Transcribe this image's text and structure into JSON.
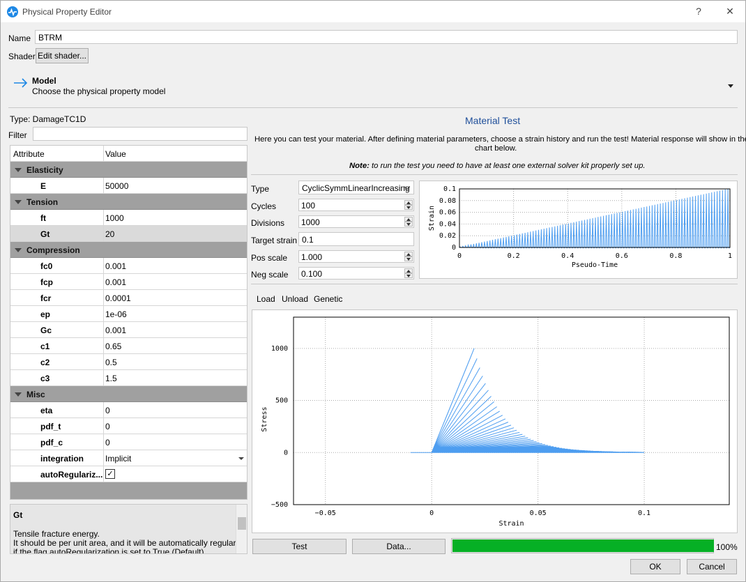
{
  "window": {
    "title": "Physical Property Editor",
    "help": "?",
    "close": "✕"
  },
  "name_label": "Name",
  "name_value": "BTRM",
  "shader_label": "Shader",
  "shader_button": "Edit shader...",
  "model": {
    "title": "Model",
    "subtitle": "Choose the physical property model"
  },
  "type_line": "Type:  DamageTC1D",
  "filter_label": "Filter",
  "filter_value": "",
  "table": {
    "col_attr": "Attribute",
    "col_value": "Value",
    "rows": [
      {
        "kind": "cat",
        "name": "Elasticity"
      },
      {
        "kind": "prop",
        "name": "E",
        "value": "50000"
      },
      {
        "kind": "cat",
        "name": "Tension"
      },
      {
        "kind": "prop",
        "name": "ft",
        "value": "1000"
      },
      {
        "kind": "prop",
        "name": "Gt",
        "value": "20",
        "selected": true
      },
      {
        "kind": "cat",
        "name": "Compression"
      },
      {
        "kind": "prop",
        "name": "fc0",
        "value": "0.001"
      },
      {
        "kind": "prop",
        "name": "fcp",
        "value": "0.001"
      },
      {
        "kind": "prop",
        "name": "fcr",
        "value": "0.0001"
      },
      {
        "kind": "prop",
        "name": "ep",
        "value": "1e-06"
      },
      {
        "kind": "prop",
        "name": "Gc",
        "value": "0.001"
      },
      {
        "kind": "prop",
        "name": "c1",
        "value": "0.65"
      },
      {
        "kind": "prop",
        "name": "c2",
        "value": "0.5"
      },
      {
        "kind": "prop",
        "name": "c3",
        "value": "1.5"
      },
      {
        "kind": "cat",
        "name": "Misc"
      },
      {
        "kind": "prop",
        "name": "eta",
        "value": "0"
      },
      {
        "kind": "prop",
        "name": "pdf_t",
        "value": "0"
      },
      {
        "kind": "prop",
        "name": "pdf_c",
        "value": "0"
      },
      {
        "kind": "prop",
        "name": "integration",
        "value": "Implicit",
        "dropdown": true
      },
      {
        "kind": "prop",
        "name": "autoRegulariz...",
        "value": "✓",
        "checkbox": true
      }
    ]
  },
  "description": {
    "title": "Gt",
    "line1": "Tensile fracture energy.",
    "line2": "It should be per unit area, and it will be automatically regularized",
    "line3": "if the flag autoRegularization is set to True (Default)."
  },
  "material_test": {
    "title": "Material Test",
    "intro1": "Here you can test your material. After defining material parameters, choose a strain history and run the test! Material response will show in the",
    "intro2": "chart below.",
    "note_bold": "Note:",
    "note_rest": " to run the test you need to have at least one external solver kit properly set up."
  },
  "params": {
    "type_label": "Type",
    "type_value": "CyclicSymmLinearIncreasing",
    "cycles_label": "Cycles",
    "cycles_value": "100",
    "divisions_label": "Divisions",
    "divisions_value": "1000",
    "target_label": "Target strain",
    "target_value": "0.1",
    "pos_label": "Pos scale",
    "pos_value": "1.000",
    "neg_label": "Neg scale",
    "neg_value": "0.100"
  },
  "tabs": [
    "Load",
    "Unload",
    "Genetic"
  ],
  "buttons": {
    "test": "Test",
    "data": "Data...",
    "ok": "OK",
    "cancel": "Cancel"
  },
  "progress": {
    "value": 100,
    "text": "100%",
    "color": "#06b025"
  },
  "chart_data": [
    {
      "type": "line",
      "title": "",
      "xlabel": "Pseudo-Time",
      "ylabel": "Strain",
      "xlim": [
        0,
        1
      ],
      "ylim": [
        0,
        0.1
      ],
      "xticks": [
        "0",
        "0.2",
        "0.4",
        "0.6",
        "0.8",
        "1"
      ],
      "yticks": [
        "0",
        "0.02",
        "0.04",
        "0.06",
        "0.08",
        "0.1"
      ],
      "series": [
        {
          "description": "cyclic strain history, 100 cycles, amplitude increasing from 0.001 to 0.1, negative side 0.1 x positive",
          "color": "#4d9df0",
          "cycles": 100,
          "amp_start": 0.001,
          "amp_end": 0.1,
          "neg_scale": 0.1
        }
      ],
      "grid": true
    },
    {
      "type": "line",
      "title": "",
      "xlabel": "Strain",
      "ylabel": "Stress",
      "xlim": [
        -0.065,
        0.14
      ],
      "ylim": [
        -500,
        1300
      ],
      "xticks": [
        "−0.05",
        "0",
        "0.05",
        "0.1"
      ],
      "yticks": [
        "−500",
        "0",
        "500",
        "1000"
      ],
      "series": [
        {
          "description": "stress-strain response: softening loops, peak stress 1000 at strain 0.02, decaying to 0 near strain 0.1",
          "color": "#4d9df0",
          "peak_strain": 0.02,
          "peak_stress": 1000,
          "end_strain": 0.1,
          "neg_strain_end": -0.01
        }
      ],
      "grid": true
    }
  ]
}
